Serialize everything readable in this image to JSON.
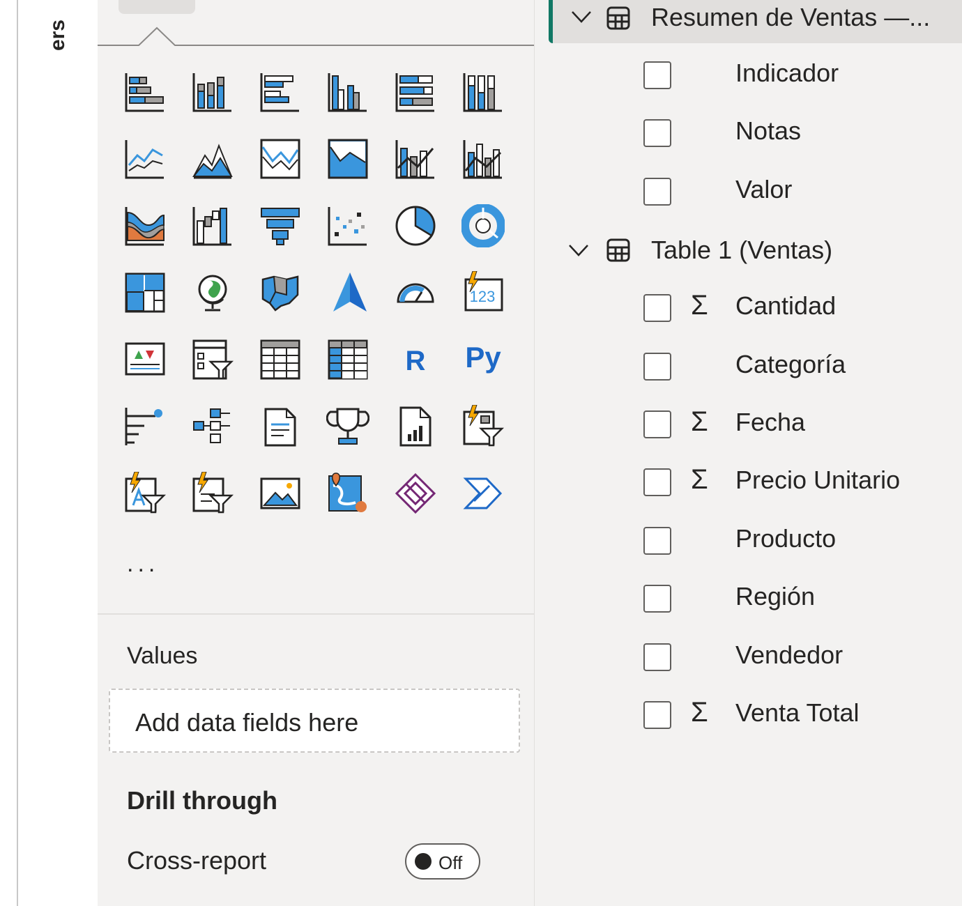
{
  "left_strip": {
    "label": "ers"
  },
  "visualizations": {
    "icons": [
      "stacked-bar-chart-icon",
      "stacked-column-chart-icon",
      "clustered-bar-chart-icon",
      "clustered-column-chart-icon",
      "100-stacked-bar-chart-icon",
      "100-stacked-column-chart-icon",
      "line-chart-icon",
      "area-chart-icon",
      "stacked-area-chart-icon",
      "100-stacked-area-chart-icon",
      "line-and-stacked-column-chart-icon",
      "line-and-clustered-column-chart-icon",
      "ribbon-chart-icon",
      "waterfall-chart-icon",
      "funnel-chart-icon",
      "scatter-chart-icon",
      "pie-chart-icon",
      "donut-chart-icon",
      "treemap-icon",
      "map-icon",
      "filled-map-icon",
      "azure-map-icon",
      "gauge-icon",
      "card-icon",
      "kpi-icon",
      "slicer-icon",
      "table-icon",
      "matrix-icon",
      "r-visual-icon",
      "python-visual-icon",
      "key-influencers-icon",
      "decomposition-tree-icon",
      "qa-icon",
      "trophy-icon",
      "paginated-report-icon",
      "smart-narrative-slicer-icon",
      "text-slicer-icon",
      "list-slicer-icon",
      "image-icon",
      "arcgis-map-icon",
      "power-apps-icon",
      "power-automate-icon"
    ],
    "glyphs": {
      "r": "R",
      "py": "Py",
      "card": "123"
    },
    "more_label": "...",
    "values_label": "Values",
    "dropzone_text": "Add data fields here",
    "drill_through_label": "Drill through",
    "cross_report_label": "Cross-report",
    "toggle_state": "Off"
  },
  "data_pane": {
    "tables": [
      {
        "name": "Resumen de Ventas —...",
        "fields": [
          {
            "label": "Indicador",
            "sigma": false
          },
          {
            "label": "Notas",
            "sigma": false
          },
          {
            "label": "Valor",
            "sigma": false
          }
        ]
      },
      {
        "name": "Table 1 (Ventas)",
        "fields": [
          {
            "label": "Cantidad",
            "sigma": true
          },
          {
            "label": "Categoría",
            "sigma": false
          },
          {
            "label": "Fecha",
            "sigma": true
          },
          {
            "label": "Precio Unitario",
            "sigma": true
          },
          {
            "label": "Producto",
            "sigma": false
          },
          {
            "label": "Región",
            "sigma": false
          },
          {
            "label": "Vendedor",
            "sigma": false
          },
          {
            "label": "Venta Total",
            "sigma": true
          }
        ]
      }
    ],
    "sigma_symbol": "Σ"
  },
  "colors": {
    "accent": "#117865",
    "viz_blue": "#3a96dd",
    "viz_dark": "#252423",
    "viz_gray": "#a19f9d",
    "lightning": "#f7a800"
  }
}
